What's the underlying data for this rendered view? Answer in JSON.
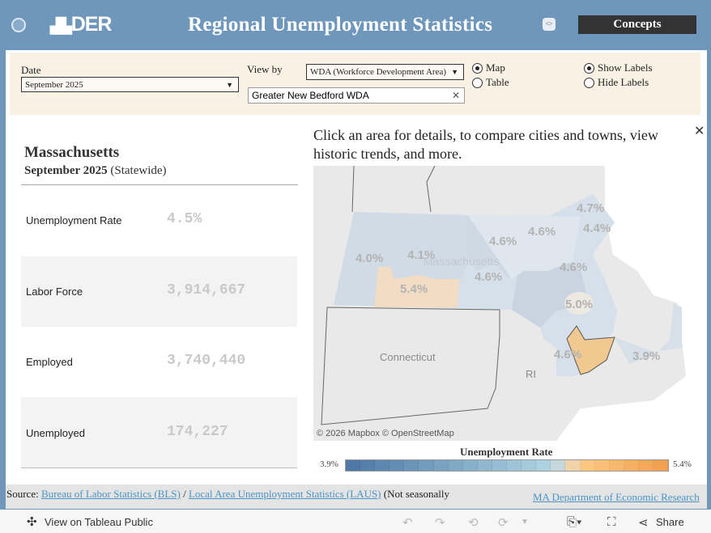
{
  "header": {
    "logo": "DER",
    "title": "Regional Unemployment Statistics",
    "concepts_label": "Concepts"
  },
  "filters": {
    "date_label": "Date",
    "date_value": "September 2025",
    "viewby_label": "View by",
    "viewby_value": "WDA (Workforce Development Area)",
    "area_value": "Greater New Bedford WDA",
    "view_options": [
      {
        "label": "Map",
        "selected": true
      },
      {
        "label": "Table",
        "selected": false
      }
    ],
    "label_options": [
      {
        "label": "Show Labels",
        "selected": true
      },
      {
        "label": "Hide Labels",
        "selected": false
      }
    ]
  },
  "summary": {
    "state": "Massachusetts",
    "period": "September 2025",
    "scope": "(Statewide)",
    "rows": [
      {
        "label": "Unemployment Rate",
        "value": "4.5%"
      },
      {
        "label": "Labor Force",
        "value": "3,914,667"
      },
      {
        "label": "Employed",
        "value": "3,740,440"
      },
      {
        "label": "Unemployed",
        "value": "174,227"
      }
    ]
  },
  "map": {
    "instruction": "Click an area for details, to compare cities and towns, view historic trends, and more.",
    "labels": [
      "4.7%",
      "4.4%",
      "4.6%",
      "4.6%",
      "4.0%",
      "4.1%",
      "4.6%",
      "4.6%",
      "5.4%",
      "5.0%",
      "4.6%",
      "3.9%"
    ],
    "places": {
      "ma": "Massachusetts",
      "ct": "Connecticut",
      "ri": "RI"
    },
    "attribution": "© 2026 Mapbox  © OpenStreetMap",
    "selected_color": "#f1c890"
  },
  "legend": {
    "title": "Unemployment Rate",
    "min": "3.9%",
    "max": "5.4%",
    "colors": [
      "#4e79a7",
      "#5580ab",
      "#5c87b0",
      "#638db4",
      "#6a94b8",
      "#729bbd",
      "#79a2c1",
      "#80a9c5",
      "#87b0ca",
      "#8fb7ce",
      "#96bdd3",
      "#9dc4d7",
      "#a5cbdb",
      "#acd1e0",
      "#c5d7da",
      "#f0d3a8",
      "#fdc77f",
      "#fbbf75",
      "#f9b86b",
      "#f7b062",
      "#f6a859",
      "#f5a050"
    ]
  },
  "footer": {
    "source_label": "Source:",
    "bls_link": "Bureau of Labor Statistics (BLS)",
    "sep": "/",
    "laus_link": "Local Area Unemployment Statistics (LAUS)",
    "note": "(Not seasonally",
    "research_link": "MA Department of Economic Research"
  },
  "toolbar": {
    "tableau": "View on Tableau Public",
    "share": "Share"
  }
}
